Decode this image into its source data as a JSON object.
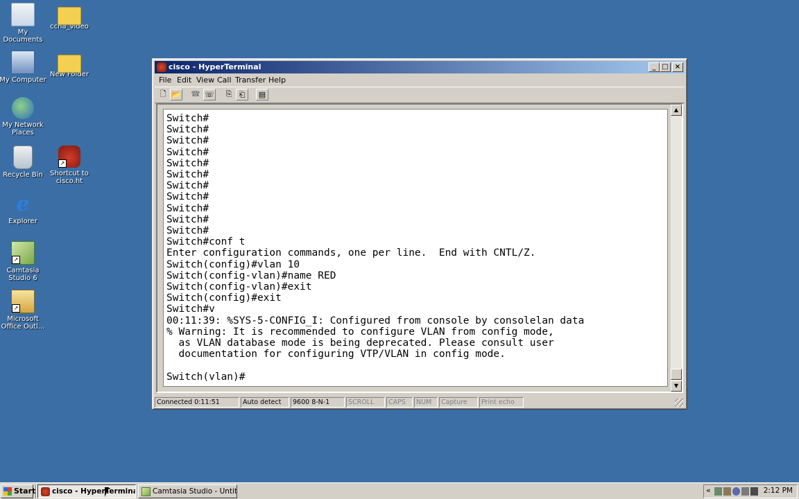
{
  "desktop": {
    "icons": [
      {
        "label": "My Documents",
        "icon": "my-documents-icon"
      },
      {
        "label": "ccna_video",
        "icon": "folder-icon"
      },
      {
        "label": "My Computer",
        "icon": "my-computer-icon"
      },
      {
        "label": "New Folder",
        "icon": "folder-icon"
      },
      {
        "label": "My Network Places",
        "icon": "network-places-icon"
      },
      {
        "label": "Recycle Bin",
        "icon": "recycle-bin-icon"
      },
      {
        "label": "Shortcut to cisco.ht",
        "icon": "hyperterminal-shortcut-icon"
      },
      {
        "label": "Explorer",
        "icon": "internet-explorer-icon"
      },
      {
        "label": "Camtasia Studio 6",
        "icon": "camtasia-icon"
      },
      {
        "label": "Microsoft Office Outl...",
        "icon": "outlook-icon"
      }
    ]
  },
  "window": {
    "title": "cisco - HyperTerminal",
    "controls": {
      "minimize": "_",
      "maximize": "□",
      "close": "×"
    },
    "menu": [
      "File",
      "Edit",
      "View",
      "Call",
      "Transfer",
      "Help"
    ],
    "toolbar": [
      {
        "icon": "new-icon",
        "glyph": "🗋"
      },
      {
        "icon": "open-icon",
        "glyph": "📂"
      },
      {
        "icon": "connect-icon",
        "glyph": "☎"
      },
      {
        "icon": "disconnect-icon",
        "glyph": "☏"
      },
      {
        "icon": "send-icon",
        "glyph": "⎘"
      },
      {
        "icon": "receive-icon",
        "glyph": "⎗"
      },
      {
        "icon": "properties-icon",
        "glyph": "▤"
      }
    ],
    "terminal_lines": [
      "Switch#",
      "Switch#",
      "Switch#",
      "Switch#",
      "Switch#",
      "Switch#",
      "Switch#",
      "Switch#",
      "Switch#",
      "Switch#",
      "Switch#",
      "Switch#conf t",
      "Enter configuration commands, one per line.  End with CNTL/Z.",
      "Switch(config)#vlan 10",
      "Switch(config-vlan)#name RED",
      "Switch(config-vlan)#exit",
      "Switch(config)#exit",
      "Switch#v",
      "00:11:39: %SYS-5-CONFIG_I: Configured from console by consolelan data",
      "% Warning: It is recommended to configure VLAN from config mode,",
      "  as VLAN database mode is being deprecated. Please consult user",
      "  documentation for configuring VTP/VLAN in config mode.",
      "",
      "Switch(vlan)#"
    ],
    "status": {
      "connected": "Connected 0:11:51",
      "detect": "Auto detect",
      "port": "9600 8-N-1",
      "scroll": "SCROLL",
      "caps": "CAPS",
      "num": "NUM",
      "capture": "Capture",
      "print_echo": "Print echo"
    }
  },
  "taskbar": {
    "start": "Start",
    "tasks": [
      {
        "label": "cisco - HyperTerminal",
        "active": true
      },
      {
        "label": "Camtasia Studio - Untitle...",
        "active": false
      }
    ],
    "tray_arrow": "«",
    "clock": "2:12 PM"
  }
}
